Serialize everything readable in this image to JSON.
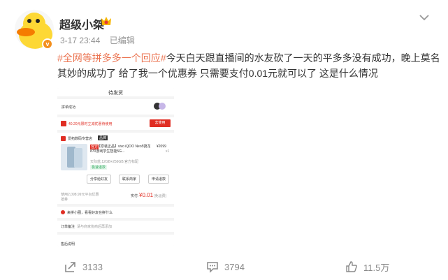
{
  "user": {
    "name": "超级小桀",
    "badge": "v"
  },
  "meta": {
    "date": "3-17 23:44",
    "edited": "已编辑"
  },
  "post": {
    "topic": "#全网等拼多多一个回应#",
    "text": "今天白天跟直播间的水友砍了一天的平多多没有成功，晚上莫名其妙的成功了 给了我一个优惠券 只需要支付0.01元就可以了 这是什么情况"
  },
  "screenshot": {
    "title": "待发货",
    "status": "拼单成功",
    "coupon": "40.20元限时立减优惠待使用",
    "coupon_btn": "去使用",
    "shop": "爱拓数码专营店",
    "shop_badge": "品牌",
    "product_tag": "官方",
    "product_name": "【原装正品】vivo iQOO Neo5骁龙870游戏学生智能5G...",
    "product_price": "¥2099",
    "product_qty": "x1",
    "product_spec": "天际蓝,12GB+256GB,官方标配",
    "product_label": "极速退款",
    "btn_share": "分享给好友",
    "btn_contact": "联系商家",
    "btn_refund": "申请退款",
    "discount_text": "使用2,098.99元平台优惠",
    "discount_sub": "抵券",
    "pay_label": "实付:",
    "pay_amount": "¥0.01",
    "pay_note": "(免运费)",
    "mini_text": "来拼小圈，看看好友在拼什么",
    "order_label": "订单备注",
    "order_placeholder": "请与商家协商后再添加",
    "service_label": "售后说明"
  },
  "footer": {
    "share_count": "3133",
    "comment_count": "3794",
    "like_count": "11.5万"
  },
  "colors": {
    "topic": "#eb7350",
    "pdd_red": "#e02e24",
    "footer_text": "#8a8a8a"
  }
}
